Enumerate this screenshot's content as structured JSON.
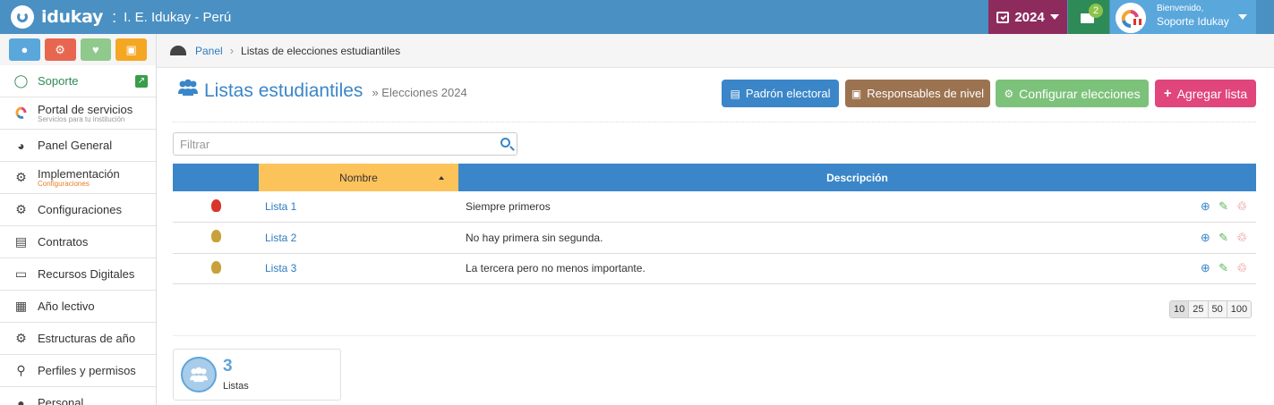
{
  "header": {
    "brand": "idukay",
    "separator": ":",
    "institution": "I. E. Idukay - Perú",
    "year": "2024",
    "messages_count": "2",
    "greeting": "Bienvenido,",
    "user_name": "Soporte Idukay",
    "colors": {
      "bar": "#4a90c2",
      "year": "#8e2b5d",
      "messages": "#2e8b57",
      "user": "#5aa7dc"
    }
  },
  "sidebar": {
    "quick_buttons": [
      {
        "icon": "user-icon",
        "color": "#5aa7dc"
      },
      {
        "icon": "cogs-icon",
        "color": "#e8664f"
      },
      {
        "icon": "heartbeat-icon",
        "color": "#8fc98b"
      },
      {
        "icon": "bank-icon",
        "color": "#f5a623"
      }
    ],
    "items": [
      {
        "label": "Soporte",
        "icon": "life-ring-icon"
      },
      {
        "label": "Portal de servicios",
        "sub": "Servicios para tu institución",
        "icon": "idukay-logo-icon"
      },
      {
        "label": "Panel General",
        "icon": "dashboard-icon"
      },
      {
        "label": "Implementación",
        "sub": "Configuraciones",
        "icon": "cogs-icon"
      },
      {
        "label": "Configuraciones",
        "icon": "cogs-icon"
      },
      {
        "label": "Contratos",
        "icon": "file-icon"
      },
      {
        "label": "Recursos Digitales",
        "icon": "laptop-icon"
      },
      {
        "label": "Año lectivo",
        "icon": "calendar-icon"
      },
      {
        "label": "Estructuras de año",
        "icon": "gear-icon"
      },
      {
        "label": "Perfiles y permisos",
        "icon": "key-icon"
      },
      {
        "label": "Personal",
        "icon": "person-icon"
      }
    ]
  },
  "breadcrumb": {
    "root": "Panel",
    "current": "Listas de elecciones estudiantiles"
  },
  "page": {
    "title": "Listas estudiantiles",
    "subtitle": "» Elecciones 2024",
    "buttons": {
      "padron": "Padrón electoral",
      "responsables": "Responsables de nivel",
      "configurar": "Configurar elecciones",
      "agregar": "Agregar lista"
    },
    "filter_placeholder": "Filtrar"
  },
  "table": {
    "columns": [
      "Nombre",
      "Descripción"
    ],
    "rows": [
      {
        "name": "Lista 1",
        "description": "Siempre primeros",
        "badge_color": "#d9342b"
      },
      {
        "name": "Lista 2",
        "description": "No hay primera sin segunda.",
        "badge_color": "#c8a13a"
      },
      {
        "name": "Lista 3",
        "description": "La tercera pero no menos importante.",
        "badge_color": "#c8a13a"
      }
    ]
  },
  "pagination": {
    "sizes": [
      "10",
      "25",
      "50",
      "100"
    ],
    "selected": "10"
  },
  "stats": {
    "count": "3",
    "label": "Listas"
  }
}
